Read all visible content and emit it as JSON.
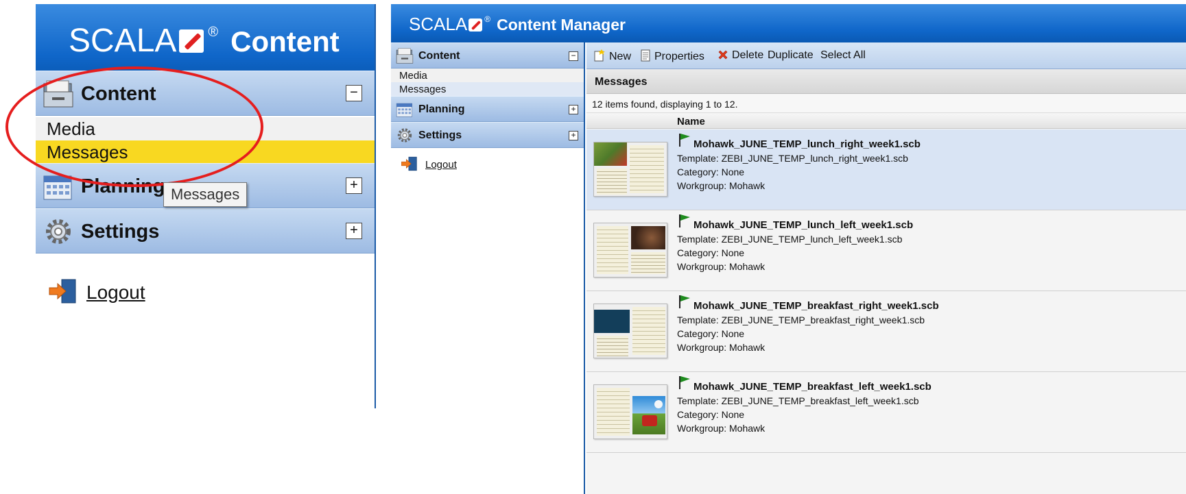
{
  "brand": {
    "logo": "SCALA",
    "registered": "®",
    "product": "Content Manager",
    "product_cropped": "Content"
  },
  "nav": {
    "sections": [
      {
        "label": "Content",
        "toggle": "−",
        "icon": "folder-icon"
      },
      {
        "label": "Planning",
        "toggle": "+",
        "icon": "calendar-icon"
      },
      {
        "label": "Settings",
        "toggle": "+",
        "icon": "gear-icon"
      }
    ],
    "content_items": [
      "Media",
      "Messages"
    ],
    "selected_item": "Messages",
    "logout": "Logout"
  },
  "tooltip": "Messages",
  "toolbar": {
    "new": "New",
    "properties": "Properties",
    "delete": "Delete",
    "duplicate": "Duplicate",
    "select_all": "Select All"
  },
  "panel": {
    "title": "Messages",
    "count": "12 items found, displaying 1 to 12.",
    "column_name": "Name"
  },
  "messages": [
    {
      "name": "Mohawk_JUNE_TEMP_lunch_right_week1.scb",
      "template": "Template: ZEBI_JUNE_TEMP_lunch_right_week1.scb",
      "category": "Category: None",
      "workgroup": "Workgroup: Mohawk",
      "selected": true
    },
    {
      "name": "Mohawk_JUNE_TEMP_lunch_left_week1.scb",
      "template": "Template: ZEBI_JUNE_TEMP_lunch_left_week1.scb",
      "category": "Category: None",
      "workgroup": "Workgroup: Mohawk",
      "selected": false
    },
    {
      "name": "Mohawk_JUNE_TEMP_breakfast_right_week1.scb",
      "template": "Template: ZEBI_JUNE_TEMP_breakfast_right_week1.scb",
      "category": "Category: None",
      "workgroup": "Workgroup: Mohawk",
      "selected": false
    },
    {
      "name": "Mohawk_JUNE_TEMP_breakfast_left_week1.scb",
      "template": "Template: ZEBI_JUNE_TEMP_breakfast_left_week1.scb",
      "category": "Category: None",
      "workgroup": "Workgroup: Mohawk",
      "selected": false
    }
  ],
  "colors": {
    "header_blue": "#0f66c9",
    "section_blue": "#9dbbe3",
    "highlight_yellow": "#f8d821",
    "selected_row": "#d9e4f4",
    "annotation_red": "#e51e1e",
    "flag_green": "#1e8c1e"
  }
}
